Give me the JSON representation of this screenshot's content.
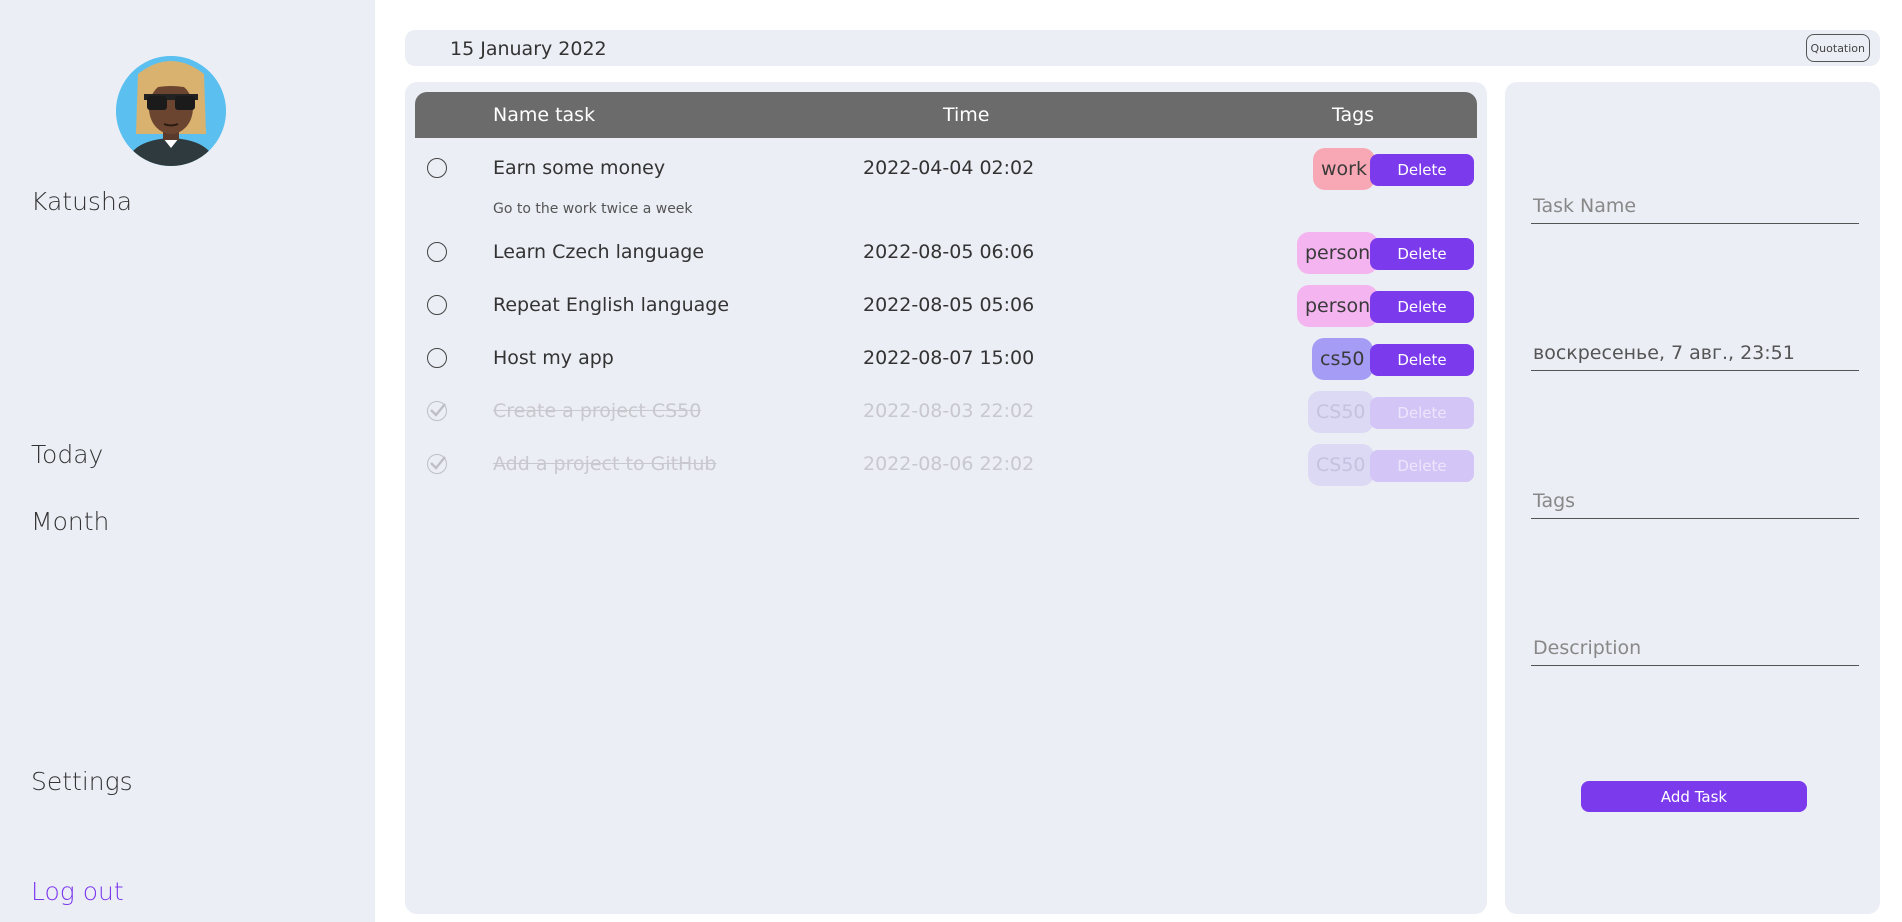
{
  "sidebar": {
    "username": "Katusha",
    "nav": {
      "today": "Today",
      "month": "Month",
      "settings": "Settings",
      "logout": "Log out"
    }
  },
  "datebar": {
    "date": "15 January 2022",
    "quotation_label": "Quotation"
  },
  "tasks": {
    "headers": {
      "name": "Name task",
      "time": "Time",
      "tags": "Tags"
    },
    "rows": [
      {
        "name": "Earn some money",
        "time": "2022-04-04 02:02",
        "tag": "work",
        "tag_color": "#f7a8b4",
        "done": false,
        "description": "Go to the work twice a week",
        "delete_label": "Delete"
      },
      {
        "name": "Learn Czech language",
        "time": "2022-08-05 06:06",
        "tag": "person",
        "tag_color": "#f3b4f0",
        "done": false,
        "delete_label": "Delete"
      },
      {
        "name": "Repeat English language",
        "time": "2022-08-05 05:06",
        "tag": "person",
        "tag_color": "#f3b4f0",
        "done": false,
        "delete_label": "Delete"
      },
      {
        "name": "Host my app",
        "time": "2022-08-07 15:00",
        "tag": "cs50",
        "tag_color": "#a59cf6",
        "done": false,
        "delete_label": "Delete"
      },
      {
        "name": "Create a project CS50",
        "time": "2022-08-03 22:02",
        "tag": "CS50",
        "tag_color": "#dcd9f4",
        "done": true,
        "delete_label": "Delete"
      },
      {
        "name": "Add a project to GitHub",
        "time": "2022-08-06 22:02",
        "tag": "CS50",
        "tag_color": "#dcd9f4",
        "done": true,
        "delete_label": "Delete"
      }
    ]
  },
  "form": {
    "task_name_placeholder": "Task Name",
    "datetime_value": "воскресенье, 7 авг., 23:51",
    "tags_placeholder": "Tags",
    "description_placeholder": "Description",
    "add_label": "Add Task"
  },
  "colors": {
    "accent": "#7c3aed",
    "panel": "#eceef5",
    "header": "#6b6b6b"
  }
}
